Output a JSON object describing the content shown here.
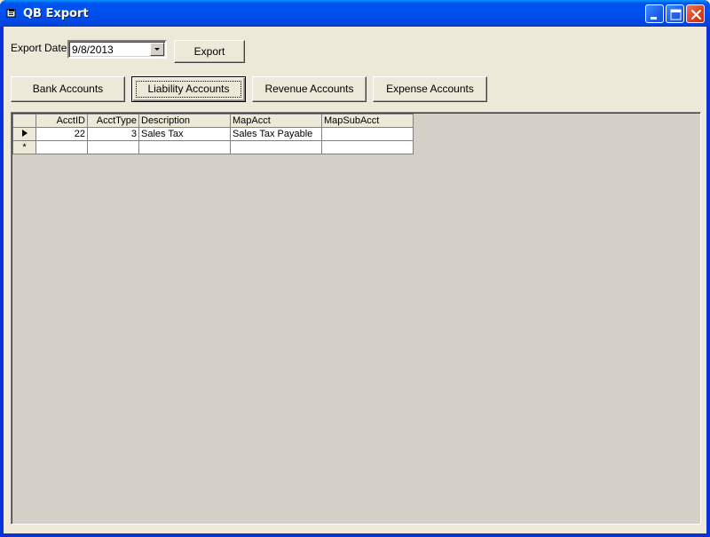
{
  "window": {
    "title": "QB Export"
  },
  "export_date": {
    "label": "Export Date",
    "value": "9/8/2013"
  },
  "buttons": {
    "export": "Export",
    "bank": "Bank Accounts",
    "liability": "Liability Accounts",
    "revenue": "Revenue Accounts",
    "expense": "Expense Accounts"
  },
  "grid": {
    "columns": [
      "AcctID",
      "AcctType",
      "Description",
      "MapAcct",
      "MapSubAcct"
    ],
    "rows": [
      {
        "AcctID": "22",
        "AcctType": "3",
        "Description": "Sales Tax",
        "MapAcct": "Sales Tax Payable",
        "MapSubAcct": ""
      }
    ],
    "current_row_marker": "▶",
    "new_row_marker": "*"
  },
  "colors": {
    "titlebar": "#0054E3",
    "face": "#ECE9D8",
    "grid_bg": "#D4D0C8"
  }
}
